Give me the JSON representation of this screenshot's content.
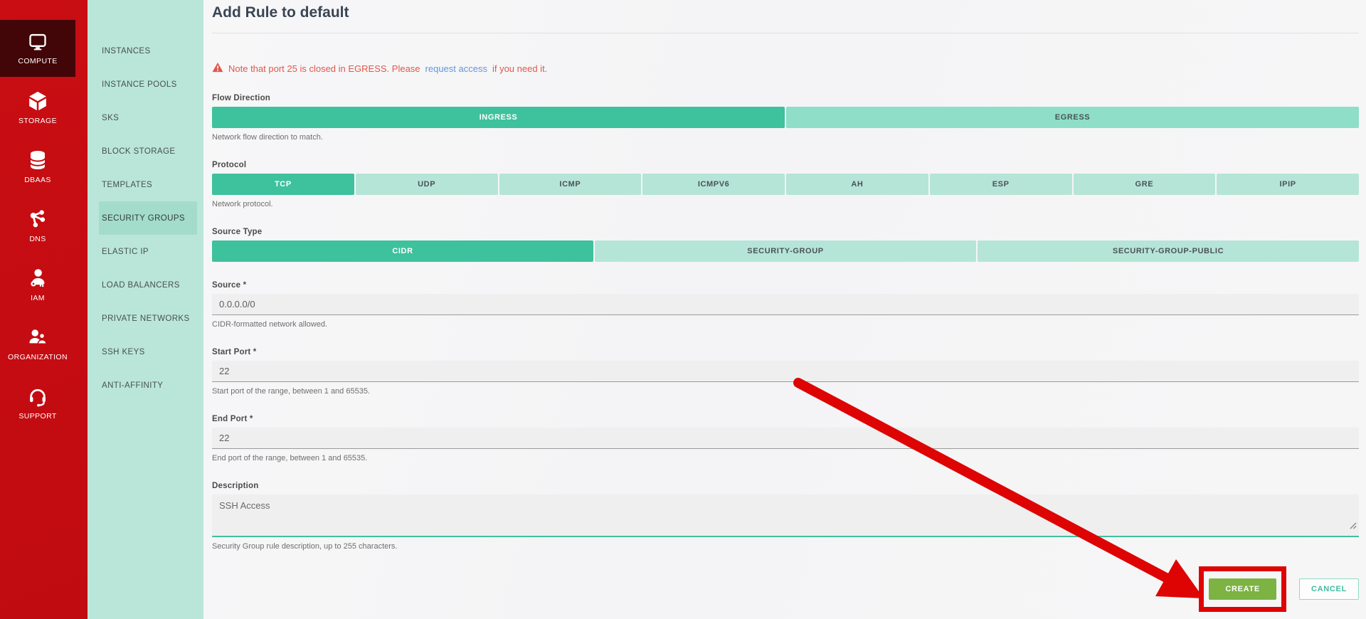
{
  "colors": {
    "sidebar_red": "#c40d12",
    "sidebar_red_active": "#420608",
    "sidebar_mint": "#bae6d9",
    "sidebar_mint_active": "#a3dccb",
    "segment_selected": "#3ec19d",
    "segment_unselected": "#b5e5d6",
    "segment_egress": "#8edec8",
    "warning_red": "#e2574b",
    "link_blue": "#6396dc",
    "create_green": "#7cb342",
    "annotation_red": "#de0404"
  },
  "sidebar_primary": {
    "items": [
      {
        "label": "COMPUTE",
        "icon": "monitor-icon",
        "active": true
      },
      {
        "label": "STORAGE",
        "icon": "cube-icon",
        "active": false
      },
      {
        "label": "DBAAS",
        "icon": "database-icon",
        "active": false
      },
      {
        "label": "DNS",
        "icon": "network-nodes-icon",
        "active": false
      },
      {
        "label": "IAM",
        "icon": "user-key-icon",
        "active": false
      },
      {
        "label": "ORGANIZATION",
        "icon": "people-icon",
        "active": false
      },
      {
        "label": "SUPPORT",
        "icon": "headset-icon",
        "active": false
      }
    ]
  },
  "sidebar_secondary": {
    "items": [
      {
        "label": "INSTANCES",
        "active": false
      },
      {
        "label": "INSTANCE POOLS",
        "active": false
      },
      {
        "label": "SKS",
        "active": false
      },
      {
        "label": "BLOCK STORAGE",
        "active": false
      },
      {
        "label": "TEMPLATES",
        "active": false
      },
      {
        "label": "SECURITY GROUPS",
        "active": true
      },
      {
        "label": "ELASTIC IP",
        "active": false
      },
      {
        "label": "LOAD BALANCERS",
        "active": false
      },
      {
        "label": "PRIVATE NETWORKS",
        "active": false
      },
      {
        "label": "SSH KEYS",
        "active": false
      },
      {
        "label": "ANTI-AFFINITY",
        "active": false
      }
    ]
  },
  "page": {
    "title": "Add Rule to default"
  },
  "warning": {
    "icon": "warning-triangle-icon",
    "text_before_link": "Note that port 25 is closed in EGRESS. Please ",
    "link_text": "request access",
    "text_after_link": " if you need it."
  },
  "form": {
    "flow_direction": {
      "label": "Flow Direction",
      "options": [
        {
          "label": "INGRESS",
          "selected": true
        },
        {
          "label": "EGRESS",
          "selected": false
        }
      ],
      "help": "Network flow direction to match."
    },
    "protocol": {
      "label": "Protocol",
      "options": [
        {
          "label": "TCP",
          "selected": true
        },
        {
          "label": "UDP",
          "selected": false
        },
        {
          "label": "ICMP",
          "selected": false
        },
        {
          "label": "ICMPV6",
          "selected": false
        },
        {
          "label": "AH",
          "selected": false
        },
        {
          "label": "ESP",
          "selected": false
        },
        {
          "label": "GRE",
          "selected": false
        },
        {
          "label": "IPIP",
          "selected": false
        }
      ],
      "help": "Network protocol."
    },
    "source_type": {
      "label": "Source Type",
      "options": [
        {
          "label": "CIDR",
          "selected": true
        },
        {
          "label": "SECURITY-GROUP",
          "selected": false
        },
        {
          "label": "SECURITY-GROUP-PUBLIC",
          "selected": false
        }
      ]
    },
    "source": {
      "label": "Source *",
      "value": "0.0.0.0/0",
      "help": "CIDR-formatted network allowed."
    },
    "start_port": {
      "label": "Start Port *",
      "value": "22",
      "help": "Start port of the range, between 1 and 65535."
    },
    "end_port": {
      "label": "End Port *",
      "value": "22",
      "help": "End port of the range, between 1 and 65535."
    },
    "description": {
      "label": "Description",
      "value": "SSH Access",
      "help": "Security Group rule description, up to 255 characters."
    }
  },
  "actions": {
    "create_label": "CREATE",
    "cancel_label": "CANCEL"
  },
  "annotation": {
    "type": "red-arrow-and-box",
    "target": "create-button"
  }
}
